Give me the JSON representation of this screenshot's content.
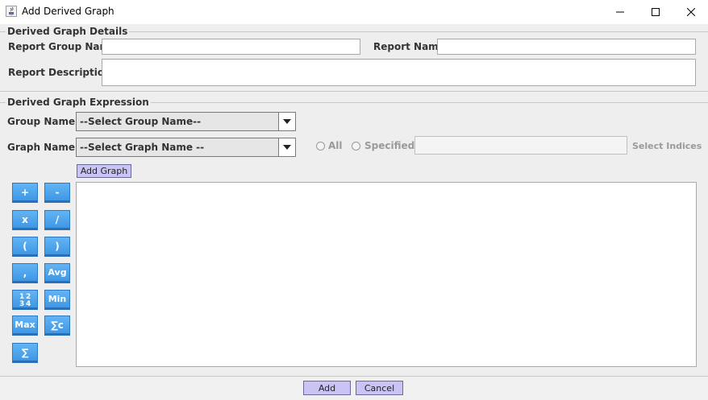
{
  "window": {
    "title": "Add Derived Graph",
    "icons": [
      "java-app-icon",
      "minimize-icon",
      "maximize-icon",
      "close-icon"
    ]
  },
  "details": {
    "legend": "Derived Graph Details",
    "report_group_name_label": "Report Group Name",
    "report_group_name_value": "",
    "report_name_label": "Report Name",
    "report_name_value": "",
    "report_description_label": "Report Description",
    "report_description_value": ""
  },
  "expression": {
    "legend": "Derived Graph Expression",
    "group_name_label": "Group Name",
    "group_name_selected": "--Select Group Name--",
    "graph_name_label": "Graph Name",
    "graph_name_selected": "--Select Graph Name --",
    "radio_all": "All",
    "radio_specified": "Specified",
    "indices_value": "",
    "select_indices_label": "Select Indices",
    "add_graph_button": "Add Graph",
    "operators": {
      "plus": "+",
      "minus": "-",
      "multiply": "x",
      "divide": "/",
      "open_paren": "(",
      "close_paren": ")",
      "comma": ",",
      "avg": "Avg",
      "min": "Min",
      "max": "Max",
      "sum_c": "∑c",
      "sum": "∑"
    },
    "expression_text": ""
  },
  "footer": {
    "add_button": "Add",
    "cancel_button": "Cancel"
  },
  "colors": {
    "operator_blue": "#4aa3ec",
    "purple_button": "#c9c4f4",
    "panel_bg": "#eeeeee"
  }
}
